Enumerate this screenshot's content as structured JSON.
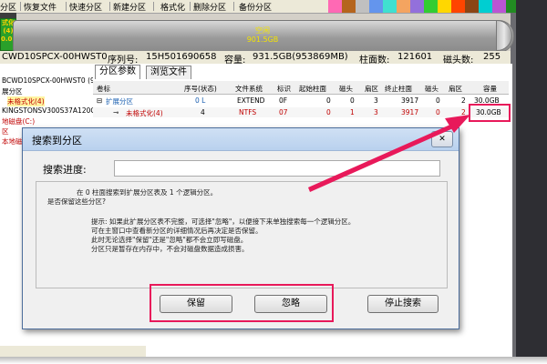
{
  "toolbar": {
    "items": [
      "分区",
      "恢复文件",
      "快速分区",
      "新建分区",
      "格式化",
      "删除分区",
      "备份分区"
    ]
  },
  "palette": [
    "#ff69b4",
    "#b5651d",
    "#c0c0c0",
    "#6495ed",
    "#40e0d0",
    "#f4a460",
    "#9370db",
    "#32cd32",
    "#ffd700",
    "#ff4500",
    "#8b4513",
    "#00ced1",
    "#ba55d3",
    "#228b22",
    "#dc143c",
    "#1e90ff"
  ],
  "logo": {
    "line1": "式化",
    "line2": "(4)",
    "line3": "0.0K"
  },
  "disk_bar": {
    "label": "空闲",
    "size": "901.5GB"
  },
  "disk_info": {
    "model": "CWD10SPCX-00HWST0",
    "serial_label": "序列号:",
    "serial": "15H501690658",
    "capacity_label": "容量:",
    "capacity": "931.5GB(953869MB)",
    "cylinders_label": "柱面数:",
    "cylinders": "121601",
    "heads_label": "磁头数:",
    "heads": "255"
  },
  "tree": {
    "lines": [
      "BCWD10SPCX-00HWST0 (9",
      "展分区",
      "未格式化(4)",
      "KINGSTONSV300S37A120G",
      "地磁盘(C:)",
      "区",
      "本地磁"
    ]
  },
  "tabs": [
    "分区参数",
    "浏览文件"
  ],
  "table": {
    "headers": [
      "卷标",
      "序号(状态)",
      "文件系统",
      "标识",
      "起始柱面",
      "磁头",
      "扇区",
      "终止柱面",
      "磁头",
      "扇区",
      "容量"
    ],
    "rows": [
      [
        "扩展分区",
        "0 L",
        "EXTEND",
        "0F",
        "0",
        "0",
        "3",
        "3917",
        "0",
        "2",
        "30.0GB"
      ],
      [
        "未格式化(4)",
        "4",
        "NTFS",
        "07",
        "0",
        "1",
        "3",
        "3917",
        "0",
        "2",
        "30.0GB"
      ]
    ]
  },
  "dialog": {
    "title": "搜索到分区",
    "close": "✕",
    "progress_label": "搜索进度:",
    "found_msg_1": "在 0 柱面搜索到扩展分区表及 1 个逻辑分区。",
    "found_msg_2": "是否保留这些分区?",
    "hint_1": "提示: 如果此扩展分区表不完整，可选择\"忽略\"，以便接下来单独搜索每一个逻辑分区。",
    "hint_2": "可在主窗口中查看新分区的详细情况后再决定是否保留。",
    "hint_3": "此时无论选择\"保留\"还是\"忽略\"都不会立即写磁盘。",
    "hint_4": "分区只是暂存在内存中，不会对磁盘数据造成损害。",
    "keep_button": "保留",
    "ignore_button": "忽略",
    "stop_button": "停止搜索"
  },
  "colors": {
    "annotation": "#e8195a",
    "disk_text": "#f4e400",
    "unformatted_text": "#c00000"
  }
}
